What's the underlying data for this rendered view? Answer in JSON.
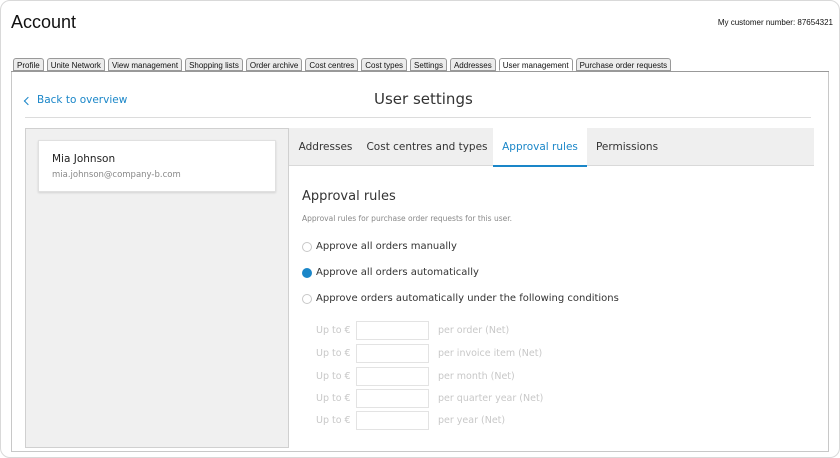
{
  "header": {
    "title": "Account",
    "customer_number": "My customer number: 87654321"
  },
  "tabs": [
    {
      "label": "Profile"
    },
    {
      "label": "Unite Network"
    },
    {
      "label": "View management"
    },
    {
      "label": "Shopping lists"
    },
    {
      "label": "Order archive"
    },
    {
      "label": "Cost centres"
    },
    {
      "label": "Cost types"
    },
    {
      "label": "Settings"
    },
    {
      "label": "Addresses"
    },
    {
      "label": "User management"
    },
    {
      "label": "Purchase order requests"
    }
  ],
  "active_tab": "User management",
  "page": {
    "back_label": "Back to overview",
    "title": "User settings"
  },
  "user": {
    "name": "Mia Johnson",
    "email": "mia.johnson@company-b.com"
  },
  "subtabs": [
    {
      "label": "Addresses"
    },
    {
      "label": "Cost centres and types"
    },
    {
      "label": "Approval rules"
    },
    {
      "label": "Permissions"
    }
  ],
  "active_subtab": "Approval rules",
  "approval": {
    "title": "Approval rules",
    "description": "Approval rules for purchase order requests for this user.",
    "options": [
      {
        "label": "Approve all orders manually",
        "checked": false
      },
      {
        "label": "Approve all orders automatically",
        "checked": true
      },
      {
        "label": "Approve orders automatically under the following conditions",
        "checked": false
      }
    ],
    "conditions": [
      {
        "prefix": "Up to €",
        "value": "",
        "suffix": "per order (Net)"
      },
      {
        "prefix": "Up to €",
        "value": "",
        "suffix": "per invoice item (Net)"
      },
      {
        "prefix": "Up to €",
        "value": "",
        "suffix": "per month (Net)"
      },
      {
        "prefix": "Up to €",
        "value": "",
        "suffix": "per quarter year (Net)"
      },
      {
        "prefix": "Up to €",
        "value": "",
        "suffix": "per year (Net)"
      }
    ]
  },
  "colors": {
    "accent": "#1a86c8",
    "muted_text": "#888888",
    "disabled_text": "#c8c8c8"
  }
}
